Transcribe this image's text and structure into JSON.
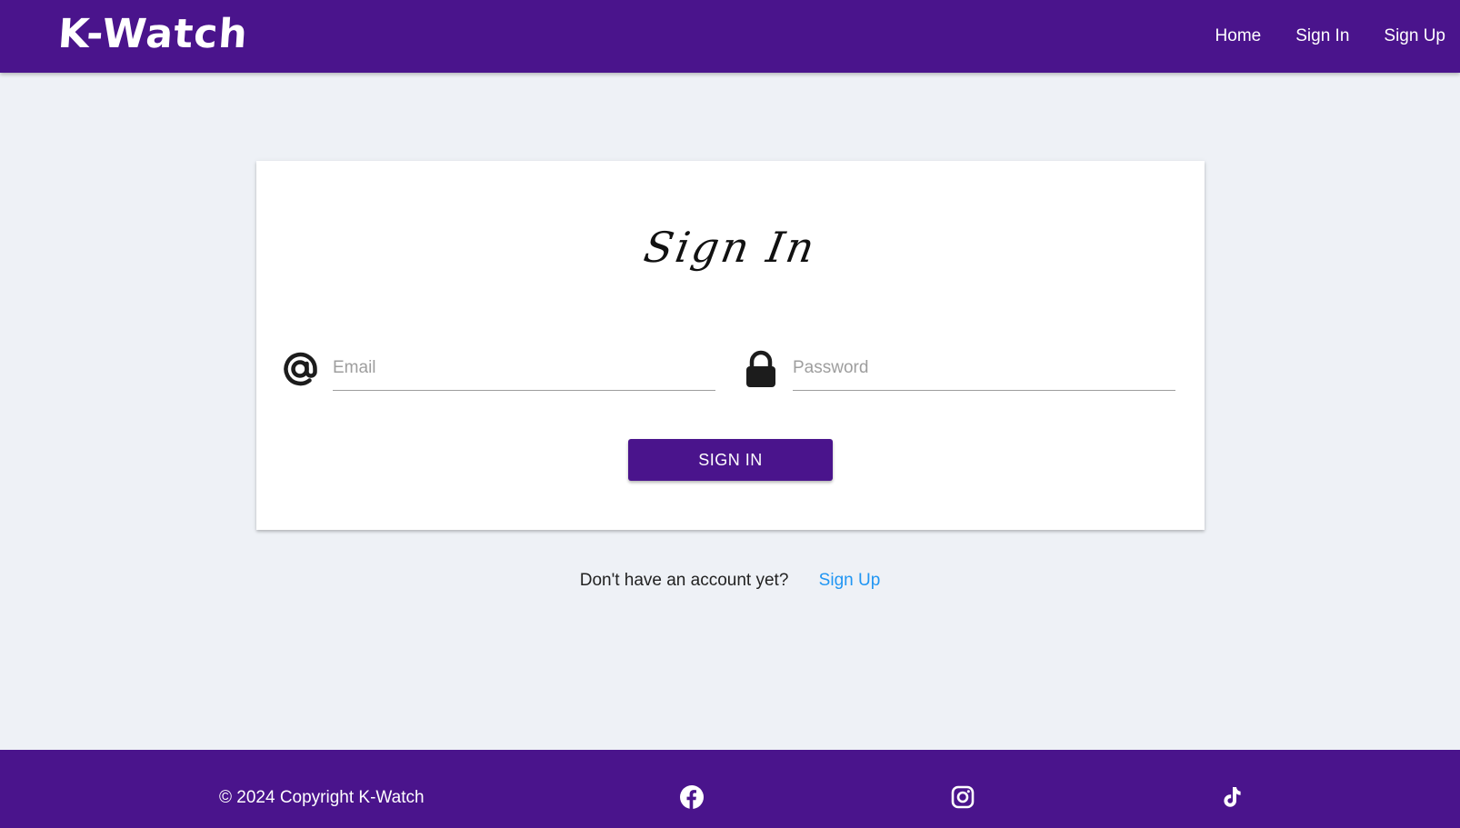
{
  "colors": {
    "primary": "#4a148c",
    "background": "#eef1f6",
    "link": "#2196f3"
  },
  "navbar": {
    "brand": "K-Watch",
    "links": [
      "Home",
      "Sign In",
      "Sign Up"
    ]
  },
  "form": {
    "title": "Sign In",
    "email": {
      "icon": "at-sign-icon",
      "placeholder": "Email",
      "value": ""
    },
    "password": {
      "icon": "lock-icon",
      "placeholder": "Password",
      "value": ""
    },
    "submit_label": "SIGN IN"
  },
  "signup": {
    "prompt": "Don't have an account yet?",
    "link": "Sign Up"
  },
  "footer": {
    "copyright": "© 2024 Copyright K-Watch",
    "social": [
      "facebook-icon",
      "instagram-icon",
      "tiktok-icon"
    ]
  }
}
